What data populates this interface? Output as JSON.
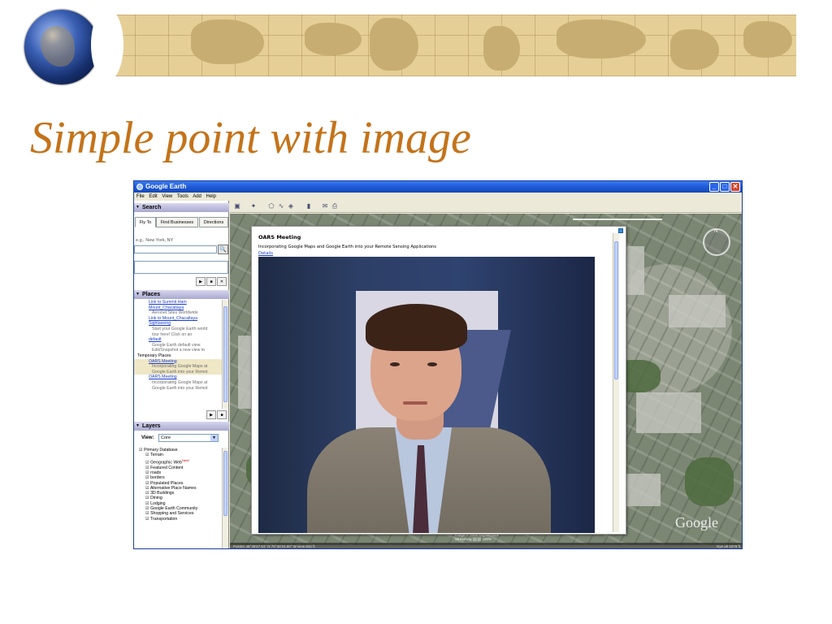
{
  "slide": {
    "title": "Simple point with image"
  },
  "window": {
    "title": "Google Earth",
    "menu": [
      "File",
      "Edit",
      "View",
      "Tools",
      "Add",
      "Help"
    ],
    "buttons": {
      "minimize": "_",
      "maximize": "□",
      "close": "✕"
    }
  },
  "search": {
    "heading": "Search",
    "tabs": [
      "Fly To",
      "Find Businesses",
      "Directions"
    ],
    "placeholder": "e.g., New York, NY",
    "go_icon": "🔍"
  },
  "places": {
    "heading": "Places",
    "items": [
      {
        "text": "Link to Summit Ham",
        "style": "link"
      },
      {
        "text": "Mount_Chacaltaya",
        "style": "link"
      },
      {
        "text": "Aeronet Sites Worldwide",
        "style": "muted"
      },
      {
        "text": "Link to Mount_Chacaltaya",
        "style": "link"
      },
      {
        "text": "Sightseeing",
        "style": "link"
      },
      {
        "text": "Start your Google Earth world",
        "style": "muted"
      },
      {
        "text": "tour here! Click on an",
        "style": "muted"
      },
      {
        "text": "default",
        "style": "link"
      },
      {
        "text": "Google Earth default view.",
        "style": "muted"
      },
      {
        "text": "Edit/Snapshot a new view to",
        "style": "muted"
      },
      {
        "text": "Temporary Places",
        "style": "plain"
      },
      {
        "text": "OARS Meeting",
        "style": "link-hl"
      },
      {
        "text": "Incorporating Google Maps at",
        "style": "muted-hl"
      },
      {
        "text": "Google Earth into your Remot",
        "style": "muted-hl"
      },
      {
        "text": "OARS Meeting",
        "style": "link"
      },
      {
        "text": "Incorporating Google Maps at",
        "style": "muted"
      },
      {
        "text": "Google Earth into your Remot",
        "style": "muted"
      }
    ]
  },
  "layers": {
    "heading": "Layers",
    "view_label": "View:",
    "view_value": "Core",
    "items": [
      "Primary Database",
      "Terrain",
      "Geographic Web",
      "Featured Content",
      "roads",
      "borders",
      "Populated Places",
      "Alternative Place Names",
      "3D Buildings",
      "Dining",
      "Lodging",
      "Google Earth Community",
      "Shopping and Services",
      "Transportation"
    ],
    "new_badge": "New!"
  },
  "balloon": {
    "title": "OARS Meeting",
    "description": "Incorporating Google Maps and Google Earth into your Remote Sensing Applications",
    "link": "Details"
  },
  "map": {
    "credit": "Image © 2006 DigitalGlobe",
    "streaming": "Streaming ||||||||| 100%",
    "status_left": "Pointer 45°46'27.61\" N 75°30'24.60\" W     view 842 ft",
    "status_right": "Eye alt 1578 ft",
    "logo": "Google"
  },
  "colors": {
    "title_orange": "#c4731a",
    "titlebar_blue": "#1f5ad6",
    "link_blue": "#1a3dcc"
  }
}
